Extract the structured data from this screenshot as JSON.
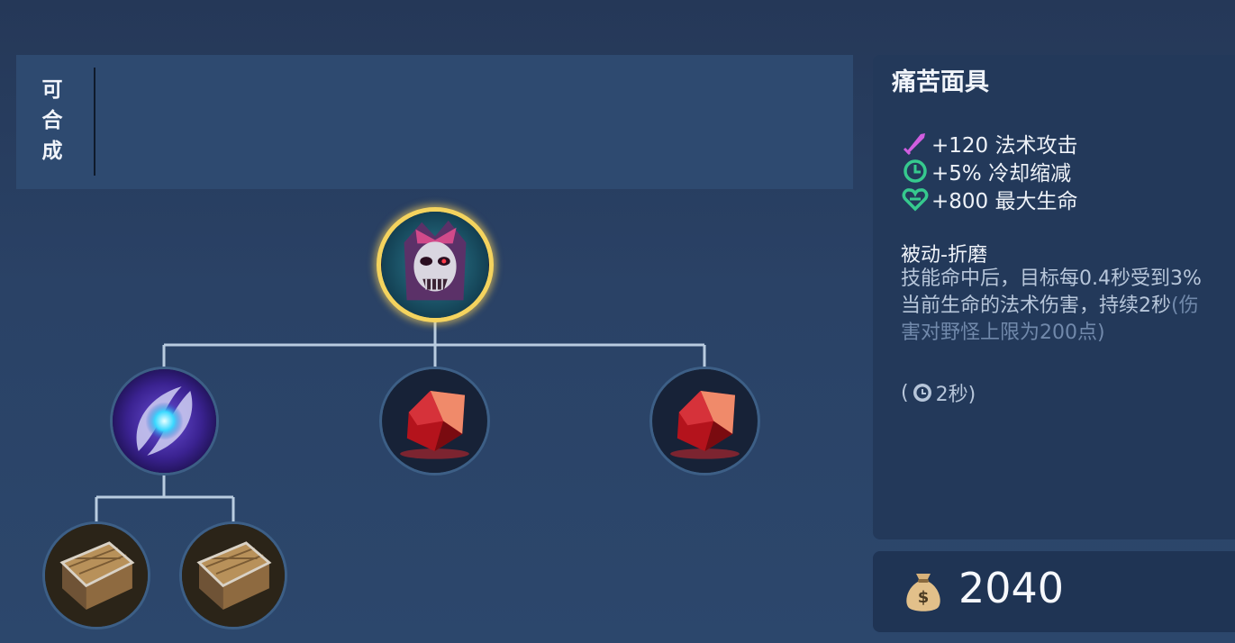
{
  "craft": {
    "label_chars": [
      "可",
      "合",
      "成"
    ]
  },
  "item": {
    "name": "痛苦面具",
    "stats": [
      {
        "icon": "magic-attack-icon",
        "text": "+120 法术攻击",
        "color": "#d15ee0"
      },
      {
        "icon": "cooldown-icon",
        "text": "+5% 冷却缩减",
        "color": "#36c98e"
      },
      {
        "icon": "max-health-icon",
        "text": "+800 最大生命",
        "color": "#36c98e"
      }
    ],
    "passive": {
      "title": "被动-折磨",
      "desc_main": "技能命中后，目标每0.4秒受到3%当前生命的法术伤害，持续2秒",
      "desc_note": "(伤害对野怪上限为200点)",
      "cooldown_open": "(",
      "cooldown_value": "2秒)"
    },
    "price": "2040"
  },
  "tree": {
    "root": {
      "icon": "mask-of-agony-icon"
    },
    "children": [
      {
        "icon": "arcane-orb-icon"
      },
      {
        "icon": "red-gem-icon"
      },
      {
        "icon": "red-gem-icon"
      }
    ],
    "grandchildren": [
      {
        "icon": "wooden-crate-icon"
      },
      {
        "icon": "wooden-crate-icon"
      }
    ]
  },
  "colors": {
    "accent_gold": "#f4d35e",
    "connector": "#b9cce0"
  }
}
